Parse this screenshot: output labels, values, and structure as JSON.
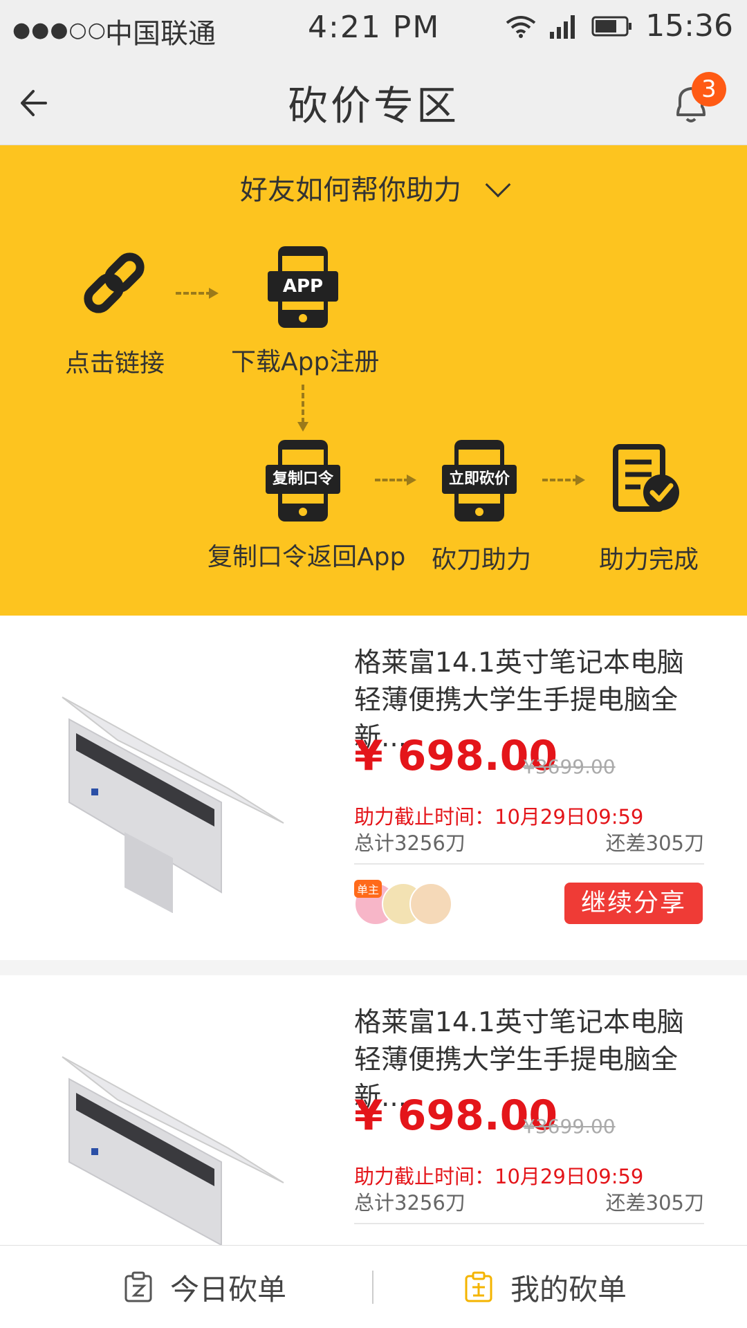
{
  "status_bar": {
    "signal": "●●●○○",
    "carrier": "中国联通",
    "time_center": "4:21 PM",
    "time_right": "15:36"
  },
  "nav": {
    "title": "砍价专区",
    "badge_count": "3",
    "back_icon": "back-arrow-icon",
    "bell_icon": "bell-icon"
  },
  "guide": {
    "heading": "好友如何帮你助力",
    "background": "#fdc41f",
    "steps": [
      {
        "label": "点击链接",
        "icon": "link-icon"
      },
      {
        "label": "下载App注册",
        "icon": "phone-app-icon",
        "tag": "APP"
      },
      {
        "label": "复制口令返回App",
        "icon": "phone-copy-icon",
        "tag": "复制口令"
      },
      {
        "label": "砍刀助力",
        "icon": "phone-bargain-icon",
        "tag": "立即砍价"
      },
      {
        "label": "助力完成",
        "icon": "checklist-done-icon"
      }
    ]
  },
  "products": [
    {
      "title": "格莱富14.1英寸笔记本电脑轻薄便携大学生手提电脑全新...",
      "price": "¥ 698.00",
      "original_price": "¥3699.00",
      "deadline": "助力截止时间：10月29日09:59",
      "total": "总计3256刀",
      "remaining": "还差305刀",
      "owner_tag": "单主",
      "share_label": "继续分享"
    },
    {
      "title": "格莱富14.1英寸笔记本电脑轻薄便携大学生手提电脑全新...",
      "price": "¥ 698.00",
      "original_price": "¥3699.00",
      "deadline": "助力截止时间：10月29日09:59",
      "total": "总计3256刀",
      "remaining": "还差305刀"
    }
  ],
  "tabbar": {
    "tabs": [
      {
        "label": "今日砍单",
        "icon": "today-order-icon"
      },
      {
        "label": "我的砍单",
        "icon": "my-order-icon"
      }
    ]
  },
  "colors": {
    "accent_red": "#e4151a",
    "button_red": "#ef3b36",
    "badge_orange": "#ff5a14"
  }
}
